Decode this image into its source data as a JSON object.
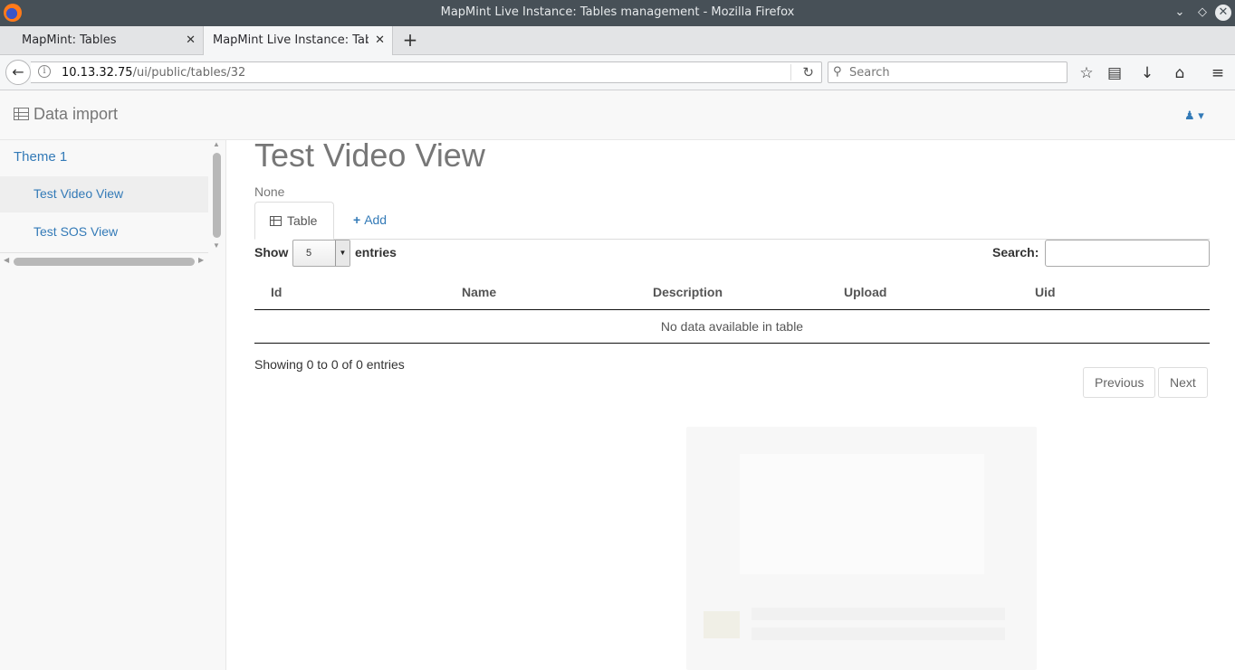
{
  "window": {
    "title": "MapMint Live Instance: Tables management - Mozilla Firefox",
    "controls": {
      "minimize": "⌄",
      "maximize": "◇",
      "close": "✕"
    }
  },
  "browser": {
    "tabs": [
      {
        "label": "MapMint: Tables",
        "close": "✕"
      },
      {
        "label": "MapMint Live Instance: Tables management",
        "close": "✕"
      }
    ],
    "new_tab": "+",
    "back": "←",
    "url_host": "10.13.32.75",
    "url_path": "/ui/public/tables/32",
    "reload": "↻",
    "search_placeholder": "Search",
    "toolbar_icons": [
      "star-icon",
      "reading-list-icon",
      "download-icon",
      "home-icon",
      "menu-icon"
    ],
    "toolbar_glyphs": {
      "bookmark": "☆",
      "library": "▤",
      "download": "↓",
      "home": "⌂",
      "menu": "≡"
    }
  },
  "app": {
    "brand": "Data import",
    "user_caret": "▾"
  },
  "sidebar": {
    "theme": "Theme 1",
    "items": [
      {
        "label": "Test Video View",
        "active": true
      },
      {
        "label": "Test SOS View",
        "active": false
      }
    ]
  },
  "main": {
    "title": "Test Video View",
    "subtitle": "None",
    "tabs": {
      "table": "Table",
      "add": "Add"
    },
    "length_prefix": "Show",
    "length_value": "5",
    "length_suffix": "entries",
    "search_label": "Search:",
    "columns": [
      "Id",
      "Name",
      "Description",
      "Upload",
      "Uid"
    ],
    "empty_message": "No data available in table",
    "info": "Showing 0 to 0 of 0 entries",
    "pagination": {
      "previous": "Previous",
      "next": "Next"
    }
  },
  "colors": {
    "link": "#337ab7",
    "titlebar": "#475057"
  }
}
